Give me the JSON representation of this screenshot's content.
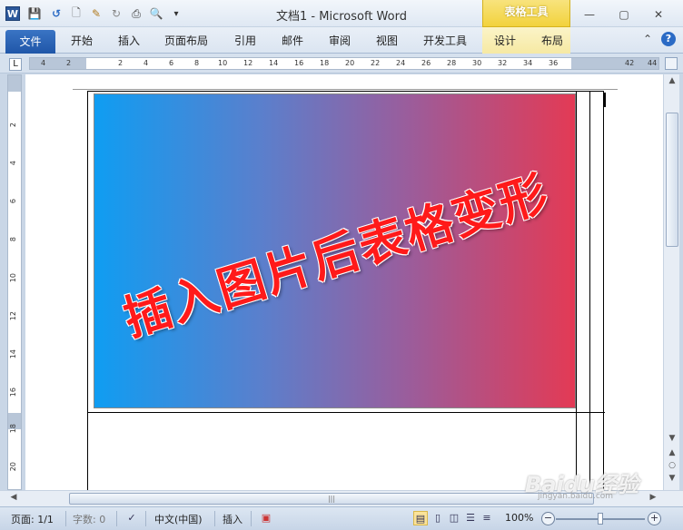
{
  "window": {
    "title": "文档1  -  Microsoft Word",
    "context_tool_title": "表格工具",
    "app_icon": "W"
  },
  "quick_access": [
    {
      "name": "save-icon",
      "glyph": "💾"
    },
    {
      "name": "undo-icon",
      "glyph": "↺"
    },
    {
      "name": "new-document-icon",
      "glyph": "🗋"
    },
    {
      "name": "format-painter-icon",
      "glyph": "✎"
    },
    {
      "name": "redo-icon",
      "glyph": "↻"
    },
    {
      "name": "print-icon",
      "glyph": "⎙"
    },
    {
      "name": "print-preview-icon",
      "glyph": "🔍"
    },
    {
      "name": "customize-toolbar-icon",
      "glyph": "▾"
    }
  ],
  "window_controls": {
    "minimize": "—",
    "maximize": "▢",
    "close": "✕"
  },
  "ribbon": {
    "file_tab": "文件",
    "tabs": [
      "开始",
      "插入",
      "页面布局",
      "引用",
      "邮件",
      "审阅",
      "视图",
      "开发工具",
      "设计",
      "布局"
    ],
    "minimize_ribbon": "⌃",
    "help": "?"
  },
  "ruler": {
    "corner": "L",
    "h_labels": [
      "4",
      "2",
      "2",
      "4",
      "6",
      "8",
      "10",
      "12",
      "14",
      "16",
      "18",
      "20",
      "22",
      "24",
      "26",
      "28",
      "30",
      "32",
      "34",
      "36",
      "42",
      "44"
    ],
    "v_labels": [
      "2",
      "4",
      "6",
      "8",
      "10",
      "12",
      "14",
      "16",
      "18",
      "20"
    ]
  },
  "document": {
    "picture_text": "插入图片后表格变形",
    "picture_gradient": [
      "#0f9df2",
      "#e33a55"
    ],
    "caption_color": "#ff1a1a"
  },
  "scrollbars": {
    "up": "▲",
    "down": "▼",
    "prev_page": "▲",
    "next_page": "▼",
    "browse": "○",
    "left": "◀",
    "right": "▶",
    "grip": "|||"
  },
  "statusbar": {
    "page": "页面: 1/1",
    "word_count": "字数: 0",
    "language": "中文(中国)",
    "insert_mode": "插入",
    "zoom": "100%",
    "zoom_out": "−",
    "zoom_in": "+"
  },
  "watermark": {
    "main": "Baidu经验",
    "sub": "jingyan.baidu.com"
  }
}
